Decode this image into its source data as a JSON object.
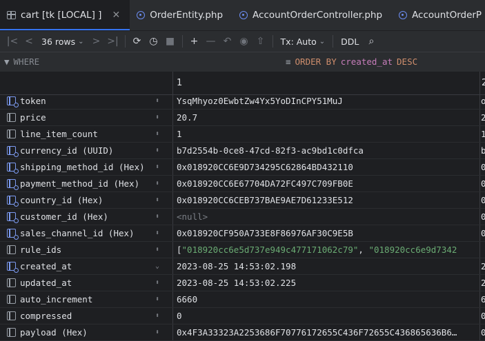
{
  "tabs": [
    {
      "label": "cart [tk [LOCAL] ]",
      "icon": "table-icon",
      "active": true
    },
    {
      "label": "OrderEntity.php",
      "icon": "php-class-icon"
    },
    {
      "label": "AccountOrderController.php",
      "icon": "php-class-icon"
    },
    {
      "label": "AccountOrderP",
      "icon": "php-class-icon"
    }
  ],
  "toolbar": {
    "rows_label": "36 rows",
    "tx_label": "Tx: Auto",
    "ddl_label": "DDL"
  },
  "filter": {
    "where_label": "WHERE",
    "order_keyword": "ORDER BY",
    "order_column": "created_at",
    "order_dir": "DESC"
  },
  "grid": {
    "column_header": "1",
    "column_header_next": "2",
    "rows": [
      {
        "field": "token",
        "value": "YsqMhyoz0EwbtZw4Yx5YoDInCPY51MuJ",
        "fk": true,
        "next": "o"
      },
      {
        "field": "price",
        "value": "20.7",
        "fk": false,
        "next": "2"
      },
      {
        "field": "line_item_count",
        "value": "1",
        "fk": false,
        "next": "1"
      },
      {
        "field": "currency_id (UUID)",
        "value": "b7d2554b-0ce8-47cd-82f3-ac9bd1c0dfca",
        "fk": true,
        "next": "b"
      },
      {
        "field": "shipping_method_id (Hex)",
        "value": "0x018920CC6E9D734295C62864BD432110",
        "fk": true,
        "next": "0"
      },
      {
        "field": "payment_method_id (Hex)",
        "value": "0x018920CC6E67704DA72FC497C709FB0E",
        "fk": true,
        "next": "0"
      },
      {
        "field": "country_id (Hex)",
        "value": "0x018920CC6CEB737BAE9AE7D61233E512",
        "fk": true,
        "next": "0"
      },
      {
        "field": "customer_id (Hex)",
        "value": "<null>",
        "fk": true,
        "null": true,
        "next": "0"
      },
      {
        "field": "sales_channel_id (Hex)",
        "value": "0x018920CF950A733E8F86976AF30C9E5B",
        "fk": true,
        "next": "0"
      },
      {
        "field": "rule_ids",
        "value_parts": [
          "[",
          "\"018920cc6e5d737e949c477171062c79\"",
          ", ",
          "\"018920cc6e9d7342"
        ],
        "fk": false,
        "next": ""
      },
      {
        "field": "created_at",
        "value": "2023-08-25 14:53:02.198",
        "fk": true,
        "sorted": true,
        "next": "2"
      },
      {
        "field": "updated_at",
        "value": "2023-08-25 14:53:02.225",
        "fk": false,
        "next": "2"
      },
      {
        "field": "auto_increment",
        "value": "6660",
        "fk": false,
        "next": "6"
      },
      {
        "field": "compressed",
        "value": "0",
        "fk": false,
        "next": "0"
      },
      {
        "field": "payload (Hex)",
        "value": "0x4F3A33323A2253686F70776172655C436F72655C436865636B6…",
        "fk": false,
        "next": "0"
      }
    ]
  }
}
